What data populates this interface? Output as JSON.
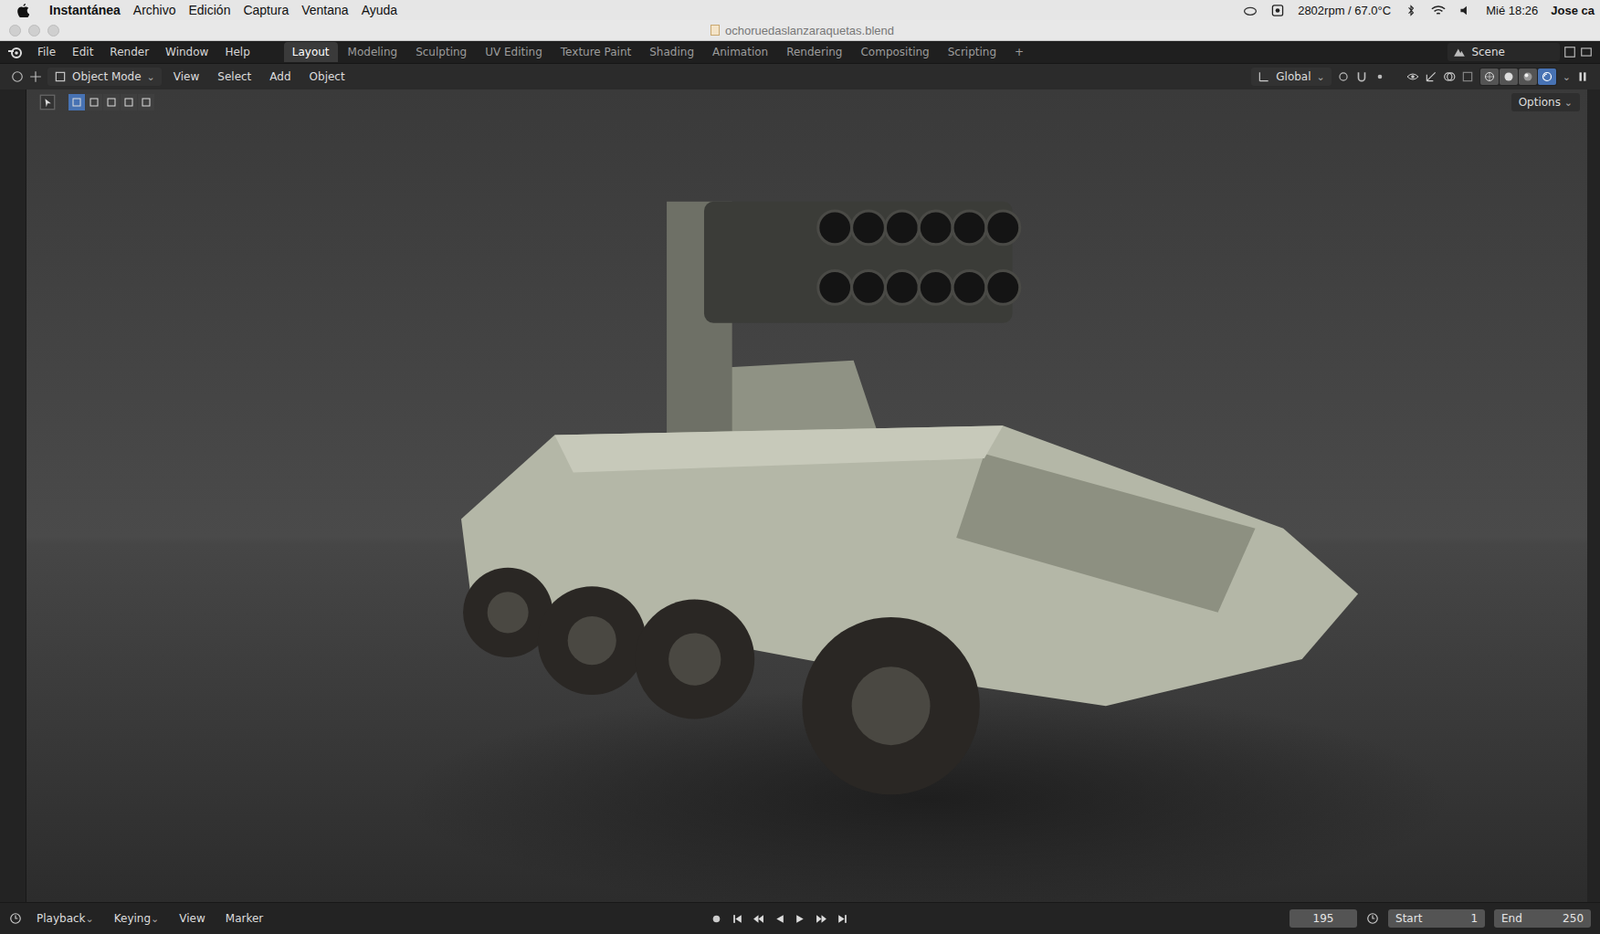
{
  "menubar": {
    "app": "Instantánea",
    "menus": [
      "Archivo",
      "Edición",
      "Captura",
      "Ventana",
      "Ayuda"
    ],
    "fan": "2802rpm / 67.0°C",
    "clock": "Mié 18:26",
    "user": "Jose ca"
  },
  "window": {
    "title": "ochoruedaslanzaraquetas.blend"
  },
  "blender_menu": [
    "File",
    "Edit",
    "Render",
    "Window",
    "Help"
  ],
  "workspace_tabs": [
    {
      "label": "Layout",
      "selected": true
    },
    {
      "label": "Modeling",
      "selected": false
    },
    {
      "label": "Sculpting",
      "selected": false
    },
    {
      "label": "UV Editing",
      "selected": false
    },
    {
      "label": "Texture Paint",
      "selected": false
    },
    {
      "label": "Shading",
      "selected": false
    },
    {
      "label": "Animation",
      "selected": false
    },
    {
      "label": "Rendering",
      "selected": false
    },
    {
      "label": "Compositing",
      "selected": false
    },
    {
      "label": "Scripting",
      "selected": false
    }
  ],
  "add_tab": "+",
  "scene": "Scene",
  "viewport_header": {
    "mode": "Object Mode",
    "menus": [
      "View",
      "Select",
      "Add",
      "Object"
    ],
    "orientation": "Global",
    "options": "Options"
  },
  "select_modes": [
    {
      "selected": true
    },
    {
      "selected": false
    },
    {
      "selected": false
    },
    {
      "selected": false
    },
    {
      "selected": false
    }
  ],
  "shading_modes": [
    {
      "selected": false
    },
    {
      "selected": false
    },
    {
      "selected": false
    },
    {
      "selected": true
    }
  ],
  "timeline": {
    "menus": [
      "Playback",
      "Keying",
      "View",
      "Marker"
    ],
    "current_frame": "195",
    "start_label": "Start",
    "start": "1",
    "end_label": "End",
    "end": "250"
  }
}
